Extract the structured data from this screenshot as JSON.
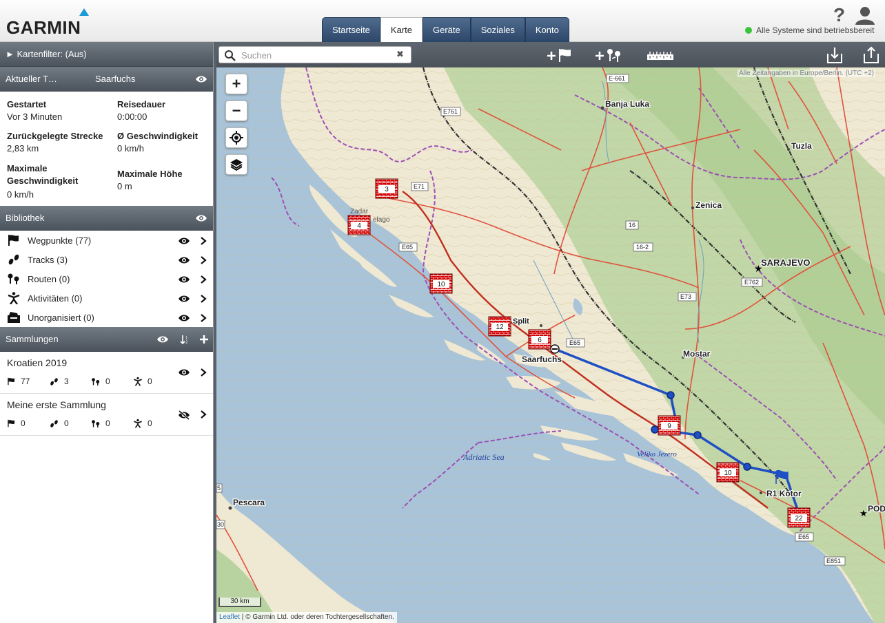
{
  "brand": {
    "logo_text": "GARMIN"
  },
  "nav": {
    "tabs": [
      {
        "label": "Startseite",
        "active": false
      },
      {
        "label": "Karte",
        "active": true
      },
      {
        "label": "Geräte",
        "active": false
      },
      {
        "label": "Soziales",
        "active": false
      },
      {
        "label": "Konto",
        "active": false
      }
    ]
  },
  "status": {
    "text": "Alle Systeme sind betriebsbereit",
    "color": "#3cc33c"
  },
  "help": {
    "glyph": "?"
  },
  "filter": {
    "label": "► Kartenfilter: (Aus)"
  },
  "current_track": {
    "title": "Aktueller T…",
    "name": "Saarfuchs",
    "stats": {
      "started_label": "Gestartet",
      "started_value": "Vor 3 Minuten",
      "duration_label": "Reisedauer",
      "duration_value": "0:00:00",
      "distance_label": "Zurückgelegte Strecke",
      "distance_value": "2,83 km",
      "avg_speed_label": "Ø Geschwindigkeit",
      "avg_speed_value": "0 km/h",
      "max_speed_label": "Maximale Geschwindigkeit",
      "max_speed_value": "0 km/h",
      "max_alt_label": "Maximale Höhe",
      "max_alt_value": "0 m"
    }
  },
  "library": {
    "title": "Bibliothek",
    "items": [
      {
        "label": "Wegpunkte (77)",
        "icon": "flag-icon"
      },
      {
        "label": "Tracks (3)",
        "icon": "footprints-icon"
      },
      {
        "label": "Routen (0)",
        "icon": "route-pins-icon"
      },
      {
        "label": "Aktivitäten (0)",
        "icon": "person-icon"
      },
      {
        "label": "Unorganisiert (0)",
        "icon": "folder-icon"
      }
    ]
  },
  "collections": {
    "title": "Sammlungen",
    "items": [
      {
        "name": "Kroatien 2019",
        "waypoints": "77",
        "tracks": "3",
        "routes": "0",
        "activities": "0",
        "visible": true
      },
      {
        "name": "Meine erste Sammlung",
        "waypoints": "0",
        "tracks": "0",
        "routes": "0",
        "activities": "0",
        "visible": false
      }
    ]
  },
  "search": {
    "placeholder": "Suchen",
    "clear_glyph": "✖"
  },
  "map": {
    "timezone_note": "Alle Zeitangaben in Europe/Berlin. (UTC +2)",
    "scale_label": "30 km",
    "attribution_link": "Leaflet",
    "attribution_text": " | © Garmin Ltd. oder deren Tochtergesellschaften.",
    "zoom_in": "+",
    "zoom_out": "−",
    "sea_label": "Adriatic Sea",
    "lake_label": "Veliko Jezero",
    "places": {
      "banja_luka": "Banja Luka",
      "tuzla": "Tuzla",
      "zenica": "Zenica",
      "sarajevo": "SARAJEVO",
      "mostar": "Mostar",
      "zadar": "Zadar",
      "zadar_sub": "elago",
      "split": "Split",
      "saarfuchs": "Saarfuchs",
      "pescara": "Pescara",
      "kotor": "R1 Kotor",
      "pod": "POD"
    },
    "roads": {
      "e661": "E-661",
      "e761": "E761",
      "e71": "E71",
      "r16": "16",
      "r16_2": "16-2",
      "e65a": "E65",
      "e762": "E762",
      "e73": "E73",
      "e65b": "E65",
      "e65c": "E65",
      "e851": "E851",
      "r5": "5",
      "r30": "30"
    },
    "clusters": [
      {
        "count": "3"
      },
      {
        "count": "4"
      },
      {
        "count": "10"
      },
      {
        "count": "12"
      },
      {
        "count": "6"
      },
      {
        "count": "9"
      },
      {
        "count": "10"
      },
      {
        "count": "22"
      }
    ],
    "colors": {
      "sea": "#a9c4d8",
      "land": "#efe8d2",
      "forest": "#b9d3a0",
      "route": "#1f4fc4",
      "road": "#e0523d",
      "border": "#9c4fb5"
    }
  }
}
